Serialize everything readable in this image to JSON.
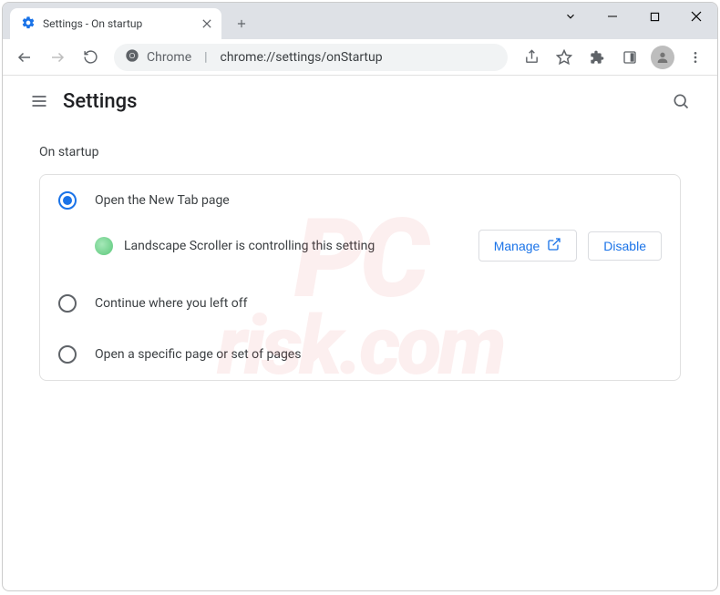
{
  "tab": {
    "title": "Settings - On startup"
  },
  "omnibox": {
    "scheme_label": "Chrome",
    "url": "chrome://settings/onStartup"
  },
  "settings": {
    "header_title": "Settings",
    "section_label": "On startup",
    "options": {
      "open_new_tab": "Open the New Tab page",
      "continue": "Continue where you left off",
      "specific": "Open a specific page or set of pages"
    },
    "extension_notice": "Landscape Scroller is controlling this setting",
    "manage_label": "Manage",
    "disable_label": "Disable"
  },
  "watermark": {
    "line1": "PC",
    "line2": "risk.com"
  }
}
